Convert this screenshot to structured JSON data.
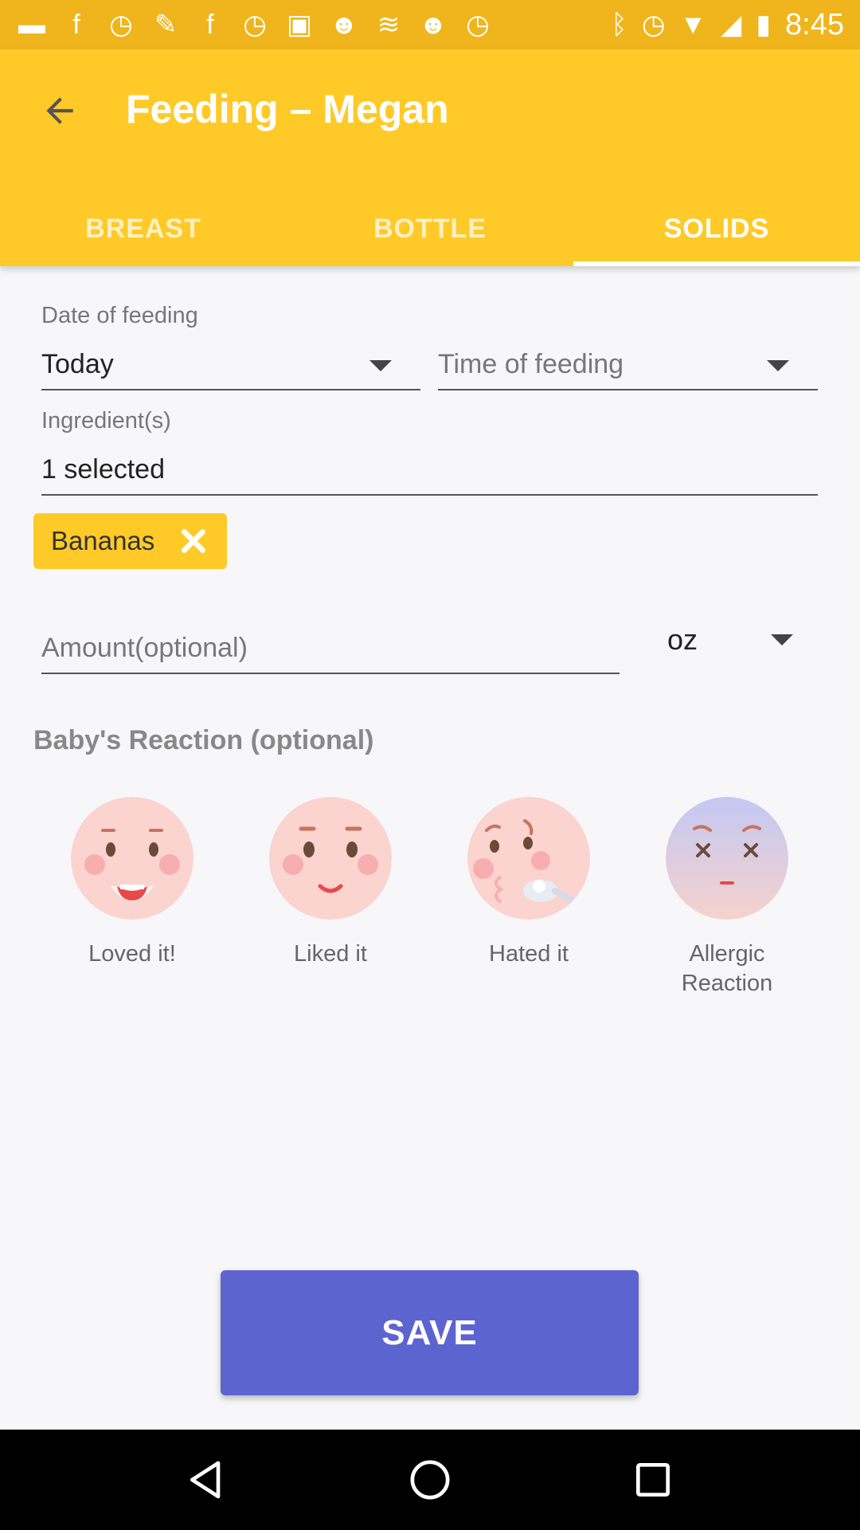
{
  "status_bar": {
    "time": "8:45",
    "icons": [
      "messages-icon",
      "facebook-icon",
      "timer-icon",
      "wrench-icon",
      "facebook-icon",
      "alarm-icon",
      "qt-icon",
      "smiley-icon",
      "money-icon",
      "smiley-icon",
      "alarm-icon",
      "bluetooth-icon",
      "alarm-icon",
      "wifi-icon",
      "signal-icon",
      "battery-icon"
    ]
  },
  "header": {
    "title": "Feeding – Megan",
    "tabs": [
      {
        "label": "BREAST",
        "active": false
      },
      {
        "label": "BOTTLE",
        "active": false
      },
      {
        "label": "SOLIDS",
        "active": true
      }
    ]
  },
  "form": {
    "date_label": "Date of feeding",
    "date_value": "Today",
    "time_placeholder": "Time of feeding",
    "ingredients_label": "Ingredient(s)",
    "ingredients_value": "1 selected",
    "chips": [
      {
        "label": "Bananas"
      }
    ],
    "amount_placeholder": "Amount(optional)",
    "unit": "oz"
  },
  "reactions": {
    "title": "Baby's Reaction (optional)",
    "items": [
      {
        "label": "Loved it!"
      },
      {
        "label": "Liked it"
      },
      {
        "label": "Hated it"
      },
      {
        "label": "Allergic Reaction"
      }
    ]
  },
  "actions": {
    "save_label": "SAVE"
  },
  "colors": {
    "status_bar": "#f0b51c",
    "app_bar": "#ffca28",
    "save_button": "#5c64cf",
    "face_pink": "#fbd3cf",
    "face_blue": "#c7ccf2"
  }
}
